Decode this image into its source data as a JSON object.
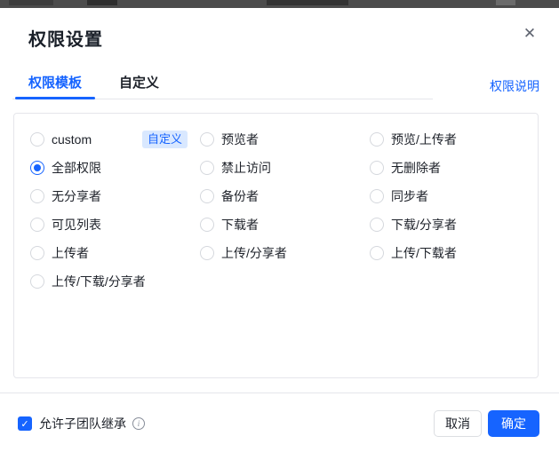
{
  "dialog": {
    "title": "权限设置",
    "close_icon": "✕"
  },
  "tabs": {
    "items": [
      {
        "label": "权限模板",
        "active": true
      },
      {
        "label": "自定义",
        "active": false
      }
    ],
    "help_link": "权限说明"
  },
  "options": {
    "columns": [
      {
        "items": [
          {
            "label": "custom",
            "badge": "自定义",
            "selected": false
          },
          {
            "label": "全部权限",
            "selected": true
          },
          {
            "label": "无分享者",
            "selected": false
          },
          {
            "label": "可见列表",
            "selected": false
          },
          {
            "label": "上传者",
            "selected": false
          },
          {
            "label": "上传/下载/分享者",
            "selected": false
          }
        ]
      },
      {
        "items": [
          {
            "label": "预览者",
            "selected": false
          },
          {
            "label": "禁止访问",
            "selected": false
          },
          {
            "label": "备份者",
            "selected": false
          },
          {
            "label": "下载者",
            "selected": false
          },
          {
            "label": "上传/分享者",
            "selected": false
          }
        ]
      },
      {
        "items": [
          {
            "label": "预览/上传者",
            "selected": false
          },
          {
            "label": "无删除者",
            "selected": false
          },
          {
            "label": "同步者",
            "selected": false
          },
          {
            "label": "下载/分享者",
            "selected": false
          },
          {
            "label": "上传/下载者",
            "selected": false
          }
        ]
      }
    ]
  },
  "footer": {
    "inherit_checkbox": {
      "label": "允许子团队继承",
      "checked": true,
      "check_glyph": "✓"
    },
    "info_glyph": "i",
    "cancel_label": "取消",
    "confirm_label": "确定"
  },
  "colors": {
    "primary": "#1664ff",
    "badge_bg": "#d9e8ff",
    "border": "#e5e6eb",
    "text": "#1d2129"
  }
}
